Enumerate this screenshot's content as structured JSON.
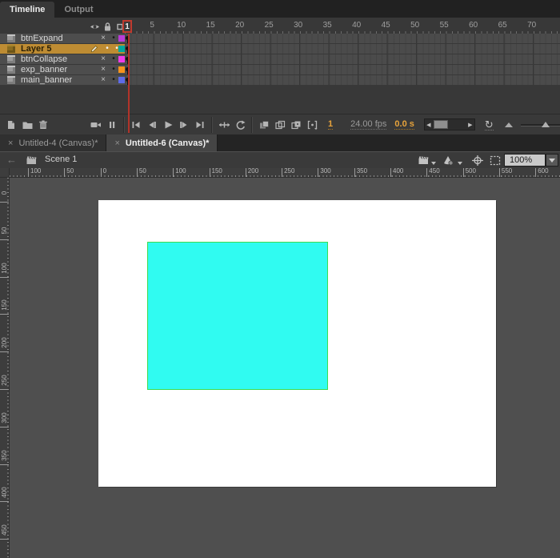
{
  "panel_tabs": {
    "timeline": "Timeline",
    "output": "Output"
  },
  "timeline": {
    "playhead_frame": "1",
    "ruler_numbers": [
      1,
      5,
      10,
      15,
      20,
      25,
      30,
      35,
      40,
      45,
      50,
      55,
      60,
      65,
      70
    ],
    "header_icons": [
      "eye-icon",
      "lock-icon",
      "outline-square-icon"
    ],
    "layers": [
      {
        "name": "btnExpand",
        "selected": false,
        "hidden": true,
        "color": "#bb3cd8"
      },
      {
        "name": "Layer 5",
        "selected": true,
        "hidden": false,
        "color": "#00a79b"
      },
      {
        "name": "btnCollapse",
        "selected": false,
        "hidden": true,
        "color": "#ef3bea"
      },
      {
        "name": "exp_banner",
        "selected": false,
        "hidden": true,
        "color": "#f7941d"
      },
      {
        "name": "main_banner",
        "selected": false,
        "hidden": true,
        "color": "#5e6be8"
      }
    ],
    "toolbar": {
      "left_icons": [
        "new-layer-icon",
        "new-folder-icon",
        "delete-icon"
      ],
      "camera_icons": [
        "camera-icon",
        "layer-bars-icon"
      ],
      "playback_icons": [
        "go-to-first-icon",
        "step-back-icon",
        "play-icon",
        "step-forward-icon",
        "go-to-last-icon"
      ],
      "frame_icons": [
        "center-frame-icon",
        "loop-icon"
      ],
      "onion_icons": [
        "onion-skin-icon",
        "onion-outline-icon",
        "edit-multiple-frames-icon",
        "modify-markers-icon"
      ],
      "current_frame": "1",
      "fps": "24.00 fps",
      "elapsed": "0.0 s",
      "reset_icon": "↻"
    }
  },
  "document_tabs": [
    {
      "label": "Untitled-4 (Canvas)*",
      "active": false
    },
    {
      "label": "Untitled-6 (Canvas)*",
      "active": true
    }
  ],
  "edit_bar": {
    "scene": "Scene 1",
    "zoom_level": "100%"
  },
  "rulers": {
    "horizontal_labels": [
      "100",
      "50",
      "0",
      "50",
      "100",
      "150",
      "200",
      "250",
      "300",
      "350",
      "400",
      "450",
      "500",
      "550",
      "600"
    ],
    "vertical_labels": [
      "0",
      "50",
      "100",
      "150",
      "200",
      "250",
      "300",
      "350",
      "400",
      "450"
    ]
  },
  "stage": {
    "fill": "#ffffff",
    "rect_fill": "#30fbf1",
    "rect_stroke": "#3bdc4e"
  },
  "glyphs": {
    "close": "×",
    "hidden": "×",
    "dot": "•",
    "back_arrow": "←",
    "scroll_left": "◀",
    "scroll_right": "▶"
  },
  "colors": {
    "selected_layer": "#be8c33",
    "playhead": "#bf3a2e",
    "accent_orange": "#e8a33b"
  }
}
